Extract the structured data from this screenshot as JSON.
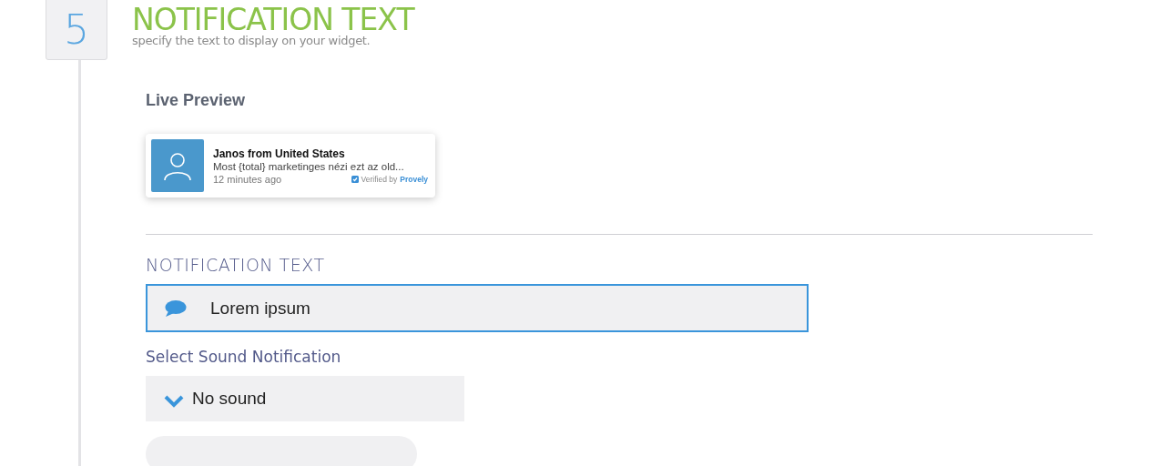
{
  "step": {
    "number": "5",
    "title": "NOTIFICATION TEXT",
    "subtitle": "specify the text to display on your widget."
  },
  "preview": {
    "heading": "Live Preview",
    "name": "Janos from United States",
    "message": "Most {total} marketinges nézi ezt az old...",
    "time": "12 minutes ago",
    "verified_label": "Verified by",
    "verified_brand": "Provely"
  },
  "notification_text": {
    "label": "NOTIFICATION TEXT",
    "value": "Lorem ipsum"
  },
  "sound": {
    "label": "Select Sound Notification",
    "value": "No sound"
  }
}
